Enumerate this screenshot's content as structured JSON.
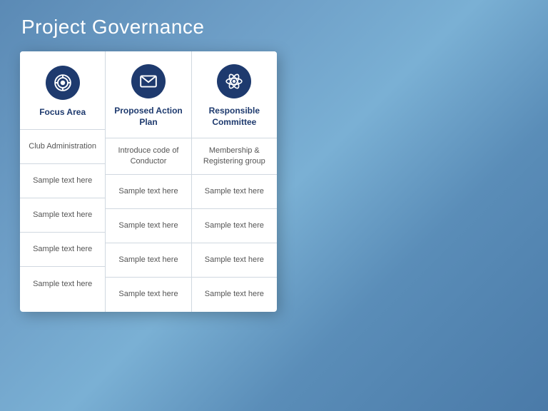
{
  "page": {
    "title": "Project Governance",
    "bg_note": "blue gradient background"
  },
  "columns": [
    {
      "id": "focus-area",
      "icon": "target",
      "title": "Focus Area",
      "rows": [
        "Club Administration",
        "Sample text here",
        "Sample text here",
        "Sample text here",
        "Sample text here"
      ]
    },
    {
      "id": "proposed-action-plan",
      "icon": "envelope",
      "title": "Proposed Action Plan",
      "rows": [
        "Introduce code of Conductor",
        "Sample text here",
        "Sample text here",
        "Sample text here",
        "Sample text here"
      ]
    },
    {
      "id": "responsible-committee",
      "icon": "atom",
      "title": "Responsible Committee",
      "rows": [
        "Membership & Registering group",
        "Sample text here",
        "Sample text here",
        "Sample text here",
        "Sample text here"
      ]
    }
  ]
}
